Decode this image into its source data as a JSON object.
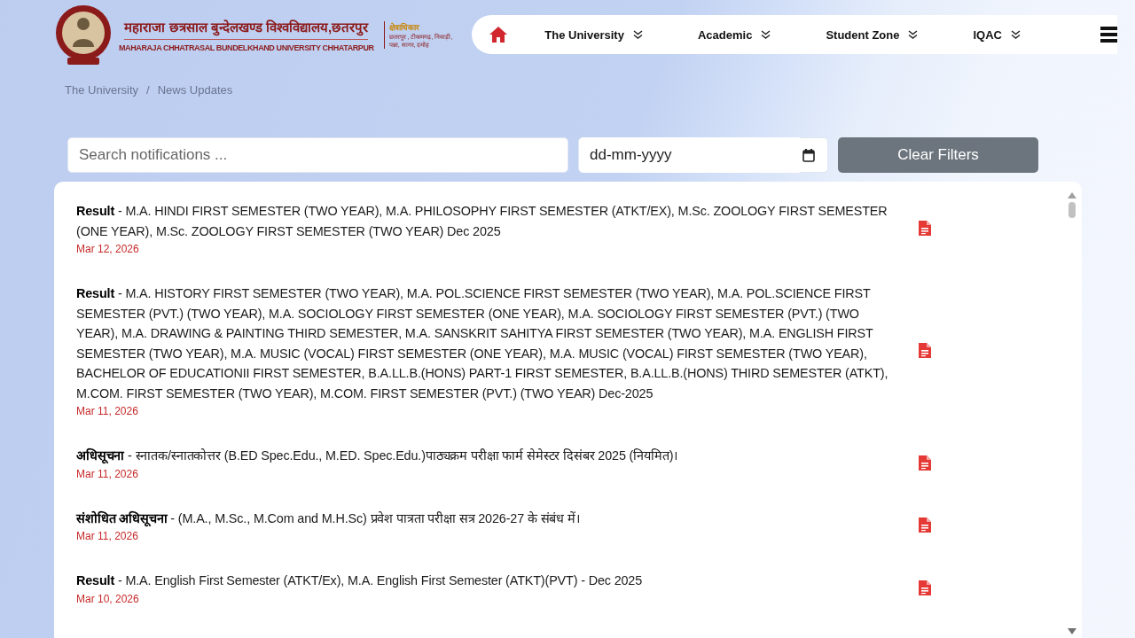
{
  "logo": {
    "title_hindi": "महाराजा छत्रसाल बुन्देलखण्ड विश्वविद्यालय,छतरपुर",
    "title_english": "MAHARAJA CHHATRASAL BUNDELKHAND UNIVERSITY CHHATARPUR",
    "jurisdiction_heading": "क्षेत्राधिकार",
    "jurisdiction_lines": [
      "छतरपुर , टीकमगढ़, निवाड़ी,",
      "पन्ना, सागर, दमोह"
    ]
  },
  "nav": {
    "items": [
      {
        "label": "The University"
      },
      {
        "label": "Academic"
      },
      {
        "label": "Student Zone"
      },
      {
        "label": "IQAC"
      }
    ]
  },
  "breadcrumb": {
    "items": [
      "The University",
      "News Updates"
    ],
    "separator": "/"
  },
  "filters": {
    "search": {
      "placeholder": "Search notifications ..."
    },
    "date": {
      "placeholder": "dd-mm-yyyy"
    },
    "clear_button": "Clear Filters"
  },
  "notices": [
    {
      "text": "**Result** - M.A. HINDI FIRST SEMESTER (TWO YEAR), M.A. PHILOSOPHY FIRST SEMESTER (ATKT/EX), M.Sc. ZOOLOGY FIRST SEMESTER (ONE YEAR), M.Sc. ZOOLOGY FIRST SEMESTER (TWO YEAR) Dec 2025",
      "date": "Mar 12, 2026"
    },
    {
      "text": "**Result** - M.A. HISTORY FIRST SEMESTER (TWO YEAR), M.A. POL.SCIENCE FIRST SEMESTER (TWO YEAR), M.A. POL.SCIENCE FIRST SEMESTER (PVT.) (TWO YEAR), M.A. SOCIOLOGY FIRST SEMESTER (ONE YEAR), M.A. SOCIOLOGY FIRST SEMESTER (PVT.) (TWO YEAR), M.A. DRAWING & PAINTING THIRD SEMESTER, M.A. SANSKRIT SAHITYA FIRST SEMESTER (TWO YEAR), M.A. ENGLISH FIRST SEMESTER (TWO YEAR), M.A. MUSIC (VOCAL) FIRST SEMESTER (ONE YEAR), M.A. MUSIC (VOCAL) FIRST SEMESTER (TWO YEAR), BACHELOR OF EDUCATIONII FIRST SEMESTER, B.A.LL.B.(HONS) PART-1 FIRST SEMESTER, B.A.LL.B.(HONS) THIRD SEMESTER (ATKT), M.COM. FIRST SEMESTER (TWO YEAR), M.COM. FIRST SEMESTER (PVT.) (TWO YEAR) Dec-2025",
      "date": "Mar 11, 2026"
    },
    {
      "text": "**अधिसूचना** - स्नातक/स्नातकोत्तर (B.ED Spec.Edu., M.ED. Spec.Edu.)पाठ्यक्रम परीक्षा फार्म सेमेस्टर दिसंबर 2025 (नियमित)।",
      "date": "Mar 11, 2026"
    },
    {
      "text": "**संशोधित अधिसूचना** - (M.A., M.Sc., M.Com and M.H.Sc) प्रवेश पात्रता परीक्षा सत्र 2026-27 के संबंध में।",
      "date": "Mar 11, 2026"
    },
    {
      "text": "**Result** - M.A. English First Semester (ATKT/Ex), M.A. English First Semester (ATKT)(PVT) - Dec 2025",
      "date": "Mar 10, 2026"
    }
  ]
}
